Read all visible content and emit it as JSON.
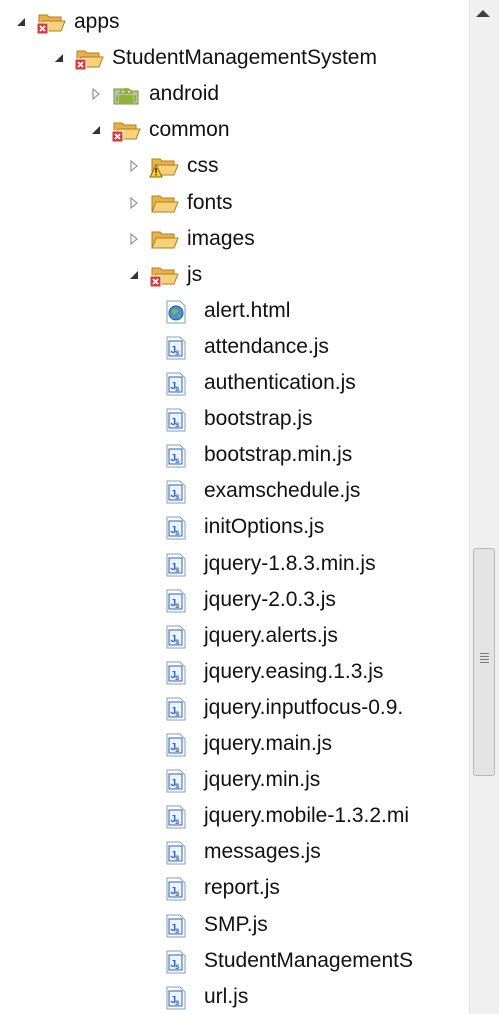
{
  "tree": {
    "items": [
      {
        "label": "apps",
        "type": "project-folder",
        "expanded": true,
        "depth": 0
      },
      {
        "label": "StudentManagementSystem",
        "type": "project-folder",
        "expanded": true,
        "depth": 1
      },
      {
        "label": "android",
        "type": "android-folder",
        "expanded": false,
        "depth": 2
      },
      {
        "label": "common",
        "type": "error-folder",
        "expanded": true,
        "depth": 2
      },
      {
        "label": "css",
        "type": "warning-folder",
        "expanded": false,
        "depth": 3
      },
      {
        "label": "fonts",
        "type": "folder",
        "expanded": false,
        "depth": 3
      },
      {
        "label": "images",
        "type": "folder",
        "expanded": false,
        "depth": 3
      },
      {
        "label": "js",
        "type": "error-folder",
        "expanded": true,
        "depth": 3
      },
      {
        "label": "alert.html",
        "type": "html-file",
        "depth": 4
      },
      {
        "label": "attendance.js",
        "type": "js-file",
        "depth": 4
      },
      {
        "label": "authentication.js",
        "type": "js-file",
        "depth": 4
      },
      {
        "label": "bootstrap.js",
        "type": "js-file",
        "depth": 4
      },
      {
        "label": "bootstrap.min.js",
        "type": "js-file",
        "depth": 4
      },
      {
        "label": "examschedule.js",
        "type": "js-file",
        "depth": 4
      },
      {
        "label": "initOptions.js",
        "type": "js-file",
        "depth": 4
      },
      {
        "label": "jquery-1.8.3.min.js",
        "type": "js-file",
        "depth": 4
      },
      {
        "label": "jquery-2.0.3.js",
        "type": "js-file",
        "depth": 4
      },
      {
        "label": "jquery.alerts.js",
        "type": "js-file",
        "depth": 4
      },
      {
        "label": "jquery.easing.1.3.js",
        "type": "js-file",
        "depth": 4
      },
      {
        "label": "jquery.inputfocus-0.9.",
        "type": "js-file",
        "depth": 4
      },
      {
        "label": "jquery.main.js",
        "type": "js-file",
        "depth": 4
      },
      {
        "label": "jquery.min.js",
        "type": "js-file",
        "depth": 4
      },
      {
        "label": "jquery.mobile-1.3.2.mi",
        "type": "js-file",
        "depth": 4
      },
      {
        "label": "messages.js",
        "type": "js-file",
        "depth": 4
      },
      {
        "label": "report.js",
        "type": "js-file",
        "depth": 4
      },
      {
        "label": "SMP.js",
        "type": "js-file",
        "depth": 4
      },
      {
        "label": "StudentManagementS",
        "type": "js-file",
        "depth": 4
      },
      {
        "label": "url.js",
        "type": "js-file",
        "depth": 4
      }
    ]
  },
  "scrollbar": {
    "position": 0.54,
    "visible_fraction": 0.22
  },
  "colors": {
    "folder": "#f3c45a",
    "error": "#d43a3a",
    "android": "#8fb33c",
    "warning": "#e8b400",
    "js": "#2a62b8"
  }
}
